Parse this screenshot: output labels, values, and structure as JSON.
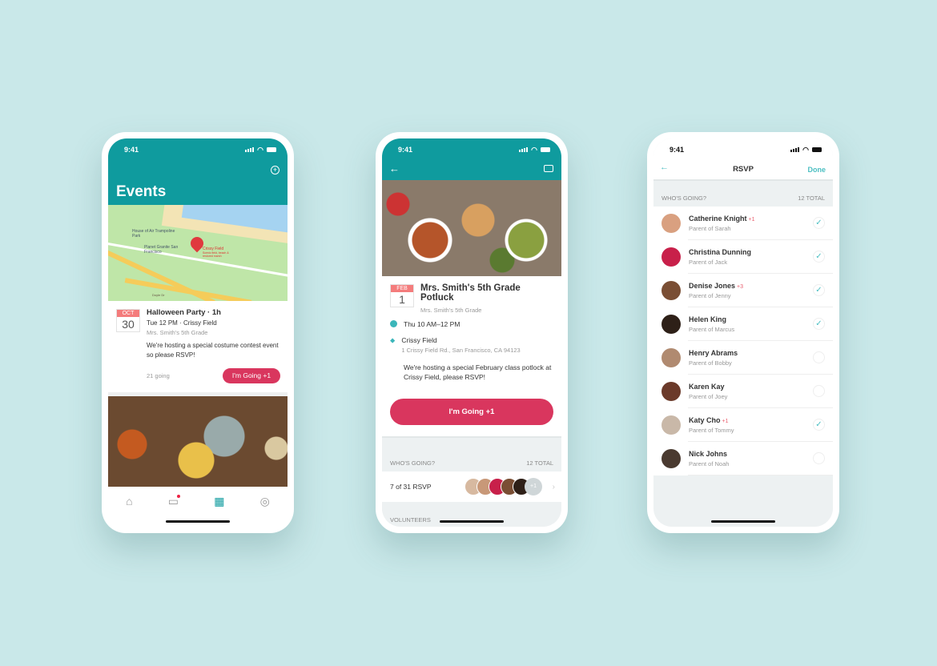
{
  "status": {
    "time": "9:41"
  },
  "events_screen": {
    "title": "Events",
    "map_labels": {
      "poi1": "House of Air Trampoline Park",
      "poi2": "Planet Granite San Francisco",
      "pin": "Crissy Field",
      "pin_sub": "Scenic field, beach & restored marsh",
      "road": "Doyle Dr"
    },
    "event": {
      "month": "OCT",
      "day": "30",
      "title": "Halloween Party · 1h",
      "when": "Tue 12 PM · Crissy Field",
      "group": "Mrs. Smith's 5th Grade",
      "description": "We're hosting a special costume contest event so please RSVP!",
      "going": "21 going",
      "button": "I'm Going +1"
    },
    "tabs": [
      {
        "icon": "home-icon"
      },
      {
        "icon": "chat-icon"
      },
      {
        "icon": "calendar-icon"
      },
      {
        "icon": "compass-icon"
      }
    ],
    "accent": "#0f9b9e"
  },
  "detail_screen": {
    "month": "FEB",
    "day": "1",
    "title": "Mrs. Smith's 5th Grade Potluck",
    "group": "Mrs. Smith's 5th Grade",
    "time": "Thu 10 AM–12 PM",
    "location": "Crissy Field",
    "address": "1 Crissy Field Rd., San Francisco, CA  94123",
    "description": "We're hosting a special February class potlock at Crissy Field, please RSVP!",
    "button": "I'm Going +1",
    "whos_going": "WHO'S GOING?",
    "total": "12 TOTAL",
    "rsvp": "7 of 31 RSVP",
    "more": "+1",
    "volunteers": "VOLUNTEERS",
    "button_color": "#d9365e"
  },
  "rsvp_screen": {
    "title": "RSVP",
    "done": "Done",
    "whos_going": "WHO'S GOING?",
    "total": "12 TOTAL",
    "people": [
      {
        "name": "Catherine Knight",
        "plus": "+1",
        "sub": "Parent of Sarah",
        "checked": true,
        "c": "#d9a080"
      },
      {
        "name": "Christina Dunning",
        "plus": "",
        "sub": "Parent of Jack",
        "checked": true,
        "c": "#c8204a"
      },
      {
        "name": "Denise Jones",
        "plus": "+3",
        "sub": "Parent of Jenny",
        "checked": true,
        "c": "#7a4e34"
      },
      {
        "name": "Helen King",
        "plus": "",
        "sub": "Parent of Marcus",
        "checked": true,
        "c": "#2e2018"
      },
      {
        "name": "Henry Abrams",
        "plus": "",
        "sub": "Parent of Bobby",
        "checked": false,
        "c": "#b08a70"
      },
      {
        "name": "Karen Kay",
        "plus": "",
        "sub": "Parent of Joey",
        "checked": false,
        "c": "#6b3a2a"
      },
      {
        "name": "Katy Cho",
        "plus": "+1",
        "sub": "Parent of Tommy",
        "checked": true,
        "c": "#c9b8a8"
      },
      {
        "name": "Nick Johns",
        "plus": "",
        "sub": "Parent of Noah",
        "checked": false,
        "c": "#4a3a30"
      }
    ]
  }
}
